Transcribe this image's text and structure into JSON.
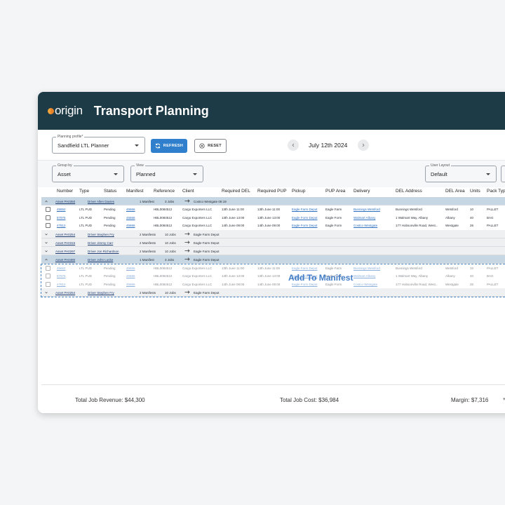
{
  "app": {
    "logo_text": "origin",
    "title": "Transport Planning"
  },
  "toolbar": {
    "planning_profile": {
      "label": "Planning profile*",
      "value": "Sandfield LTL Planner"
    },
    "refresh_label": "REFRESH",
    "reset_label": "RESET",
    "date": "July 12th 2024"
  },
  "filters": {
    "group_by": {
      "label": "Group by",
      "value": "Asset"
    },
    "view": {
      "label": "View",
      "value": "Planned"
    },
    "user_layout": {
      "label": "User Layout",
      "value": "Default"
    }
  },
  "columns": [
    "Number",
    "Type",
    "Status",
    "Manifest",
    "Reference",
    "Client",
    "Required DEL",
    "Required PUP",
    "Pickup",
    "PUP Area",
    "Delivery",
    "DEL Address",
    "DEL Area",
    "Units",
    "Pack Typ"
  ],
  "groups": [
    {
      "asset": "Asset PA0350",
      "driver": "Driver Allen Davies",
      "manifests": "1 Manifest",
      "jobs": "3 Jobs",
      "dest": "Costco Westgate 08:19",
      "expanded": true
    },
    {
      "asset": "Asset PA0254",
      "driver": "Driver Stephen Fry",
      "manifests": "2 Manifests",
      "jobs": "10 Jobs",
      "dest": "Eagle Farm Depot"
    },
    {
      "asset": "Asset PA0315",
      "driver": "Driver Jimmy Carr",
      "manifests": "2 Manifests",
      "jobs": "10 Jobs",
      "dest": "Eagle Farm Depot"
    },
    {
      "asset": "Asset PA0297",
      "driver": "Driver Jon Richardson",
      "manifests": "2 Manifests",
      "jobs": "10 Jobs",
      "dest": "Eagle Farm Depot"
    },
    {
      "asset": "Asset PA0480",
      "driver": "Driver John Locke",
      "manifests": "1 Manifest",
      "jobs": "3 Jobs",
      "dest": "Eagle Farm Depot",
      "expanded": true
    },
    {
      "asset": "Asset PA0254",
      "driver": "Driver Stephen Fry",
      "manifests": "2 Manifests",
      "jobs": "10 Jobs",
      "dest": "Eagle Farm Depot"
    }
  ],
  "jobs": [
    {
      "number": "45652",
      "type": "LTL PUD",
      "status": "Pending",
      "manifest": "45666",
      "reference": "HBL0084512",
      "client": "Cargo Exporters LLC",
      "req_del": "13th June 11:00",
      "req_pup": "13th June 11:00",
      "pickup": "Eagle Farm Depot",
      "pup_area": "Eagle Farm",
      "delivery": "Bunnings Wetsford",
      "del_address": "Bunnings Wetsford",
      "del_area": "Wetsford",
      "units": "10",
      "pack": "PALLET"
    },
    {
      "number": "87976",
      "type": "LTL PUD",
      "status": "Pending",
      "manifest": "45666",
      "reference": "HBL0084512",
      "client": "Cargo Exporters LLC",
      "req_del": "13th June 13:00",
      "req_pup": "13th June 13:00",
      "pickup": "Eagle Form Depot",
      "pup_area": "Eagle Form",
      "delivery": "Walmart Albany",
      "del_address": "1 Walmart Way, Albany",
      "del_area": "Albany",
      "units": "40",
      "pack": "BAG"
    },
    {
      "number": "47812",
      "type": "LTL PUD",
      "status": "Pending",
      "manifest": "45666",
      "reference": "HBL0084512",
      "client": "Cargo Exporters LLC",
      "req_del": "14th June 09:00",
      "req_pup": "14th June 09:00",
      "pickup": "Eagle Form Depot",
      "pup_area": "Eagle Form",
      "delivery": "Costco Westgate",
      "del_address": "177 Hobsonville Road, West...",
      "del_area": "Westgate",
      "units": "26",
      "pack": "PALLET"
    }
  ],
  "drop_zone": {
    "label": "Add To Manifest"
  },
  "footer": {
    "revenue": "Total Job Revenue: $44,300",
    "cost": "Total Job Cost: $36,984",
    "margin": "Margin: $7,316"
  },
  "colors": {
    "header_bg": "#1d3b46",
    "accent": "#2f7fcc",
    "group_expanded": "#c7d6e3"
  }
}
